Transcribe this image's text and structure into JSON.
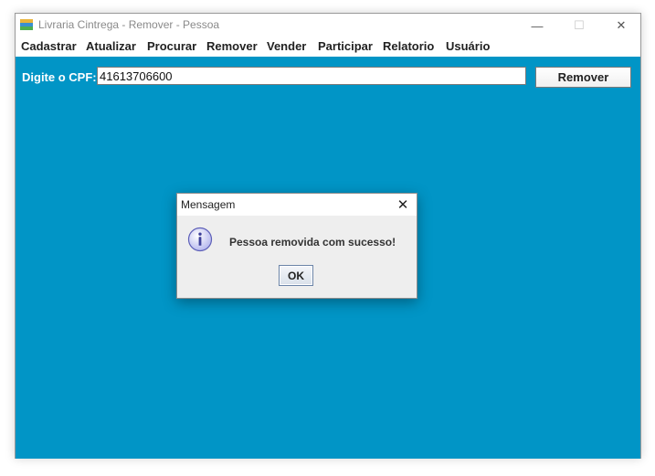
{
  "window": {
    "title": "Livraria Cintrega - Remover - Pessoa",
    "minimize_glyph": "—",
    "maximize_glyph": "☐",
    "close_glyph": "✕"
  },
  "menu": [
    {
      "label": "Cadastrar"
    },
    {
      "label": "Atualizar"
    },
    {
      "label": "Procurar"
    },
    {
      "label": "Remover"
    },
    {
      "label": "Vender"
    },
    {
      "label": "Participar"
    },
    {
      "label": "Relatorio"
    },
    {
      "label": "Usuário"
    }
  ],
  "form": {
    "cpf_label": "Digite o CPF:",
    "cpf_value": "41613706600",
    "remove_button": "Remover"
  },
  "dialog": {
    "title": "Mensagem",
    "close_glyph": "✕",
    "message": "Pessoa removida com sucesso!",
    "ok_button": "OK",
    "icon": "info-icon"
  },
  "colors": {
    "content_background": "#0195c6",
    "dialog_background": "#eeeeee"
  }
}
